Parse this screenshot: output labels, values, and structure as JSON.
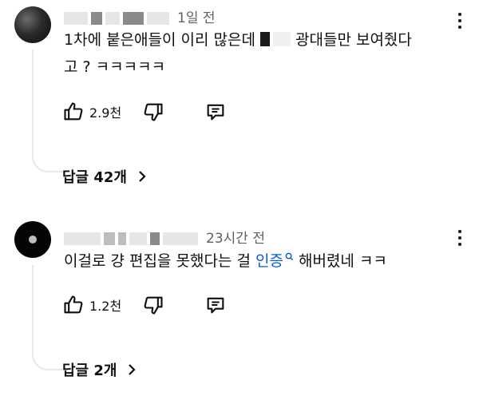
{
  "comments": [
    {
      "time": "1일 전",
      "text_a": "1차에 붙은애들이 이리 많은데",
      "text_b": "광대들만 보여줬다",
      "text_c": "고 ? ㅋㅋㅋㅋㅋ",
      "likes": "2.9천",
      "replies_label": "답글 42개"
    },
    {
      "time": "23시간 전",
      "text_a": "이걸로 걍 편집을 못했다는 걸",
      "link": "인증",
      "text_b": "해버렸네 ㅋㅋ",
      "likes": "1.2천",
      "replies_label": "답글 2개"
    }
  ],
  "icons": {
    "like": "thumb-up-icon",
    "dislike": "thumb-down-icon",
    "reply": "comment-icon",
    "more": "more-vert-icon",
    "search": "search-icon",
    "chevron": "chevron-right-icon"
  },
  "colors": {
    "link": "#065fd4",
    "meta": "#606060",
    "text": "#0f0f0f"
  }
}
